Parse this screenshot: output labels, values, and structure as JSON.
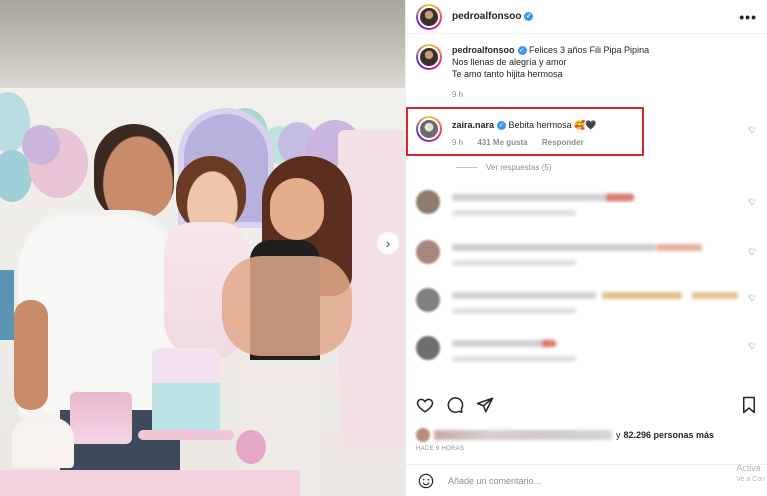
{
  "post": {
    "username": "pedroalfonsoo",
    "more_icon": "•••"
  },
  "caption": {
    "username": "pedroalfonsoo",
    "line1": "Felices 3 años Fili Pipa Pipina",
    "line2": "Nos llenas de alegría y amor",
    "line3": "Te amo tanto hijita hermosa",
    "time": "9 h"
  },
  "highlighted_comment": {
    "username": "zaira.nara",
    "text": "Bebita hermosa 🥰🖤",
    "time": "9 h",
    "likes": "431 Me gusta",
    "reply": "Responder",
    "highlight_color": "#d9262c"
  },
  "view_replies": "Ver respuestas (5)",
  "likes_line": {
    "prefix": "y",
    "count": "82.296 personas más"
  },
  "time_ago": "HACE 9 HORAS",
  "add_comment_placeholder": "Añade un comentario...",
  "watermark": {
    "line1": "Activa",
    "line2": "Ve a Con"
  },
  "colors": {
    "verified": "#3897f0",
    "secondary_text": "#8e8e8e",
    "border": "#efefef"
  },
  "icons": [
    "heart-icon",
    "comment-icon",
    "share-icon",
    "bookmark-icon",
    "emoji-icon",
    "verified-icon"
  ]
}
